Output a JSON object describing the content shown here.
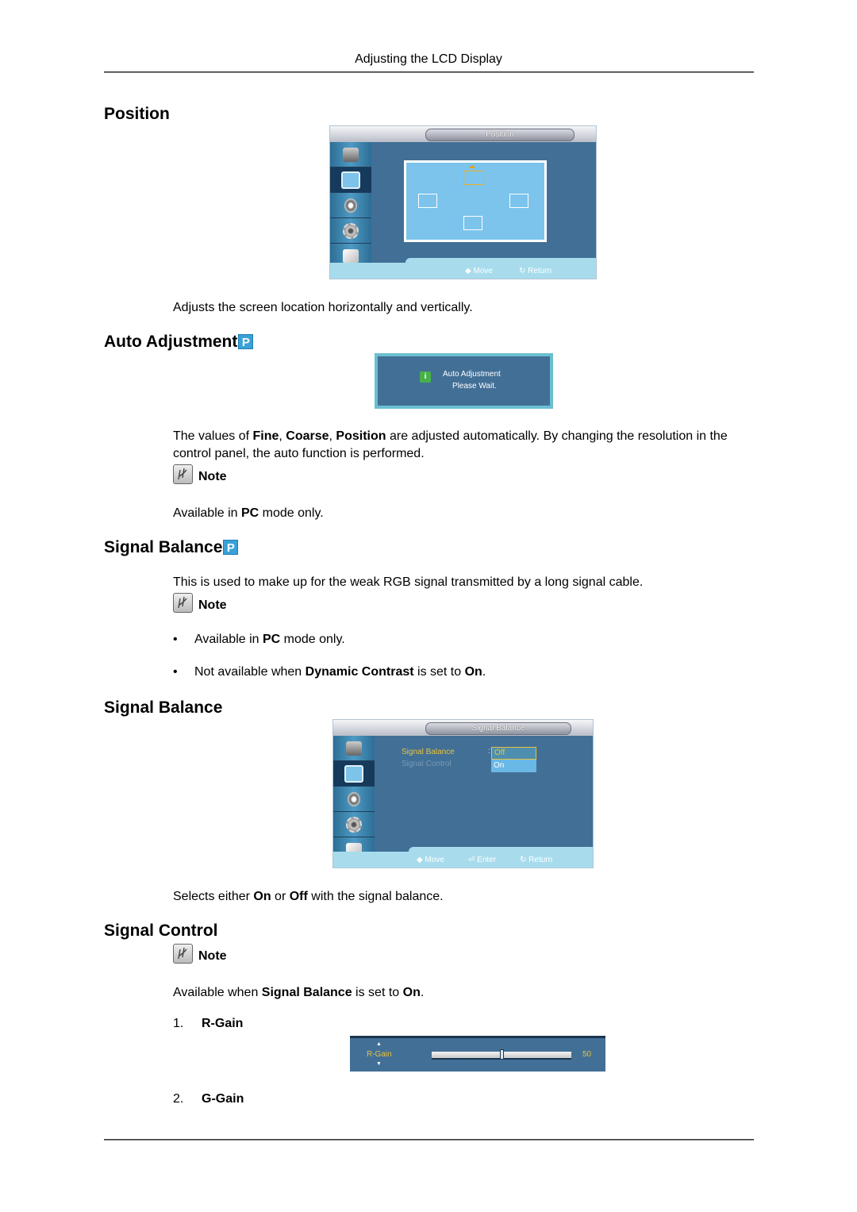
{
  "header": {
    "title": "Adjusting the LCD Display"
  },
  "sections": {
    "position": {
      "heading": "Position",
      "osd": {
        "title": "Position",
        "footer": {
          "move": "Move",
          "return": "Return"
        }
      },
      "description": "Adjusts the screen location horizontally and vertically."
    },
    "auto_adjustment": {
      "heading": "Auto Adjustment",
      "badge": "P",
      "osd": {
        "line1": "Auto Adjustment",
        "line2": "Please Wait."
      },
      "desc_parts": [
        "The values of ",
        "Fine",
        ", ",
        "Coarse",
        ", ",
        "Position",
        " are adjusted automatically. By changing the resolution in the control panel, the auto function is performed."
      ],
      "note_label": "Note",
      "note_parts": [
        "Available in ",
        "PC",
        " mode only."
      ]
    },
    "signal_balance_intro": {
      "heading": "Signal Balance",
      "badge": "P",
      "description": "This is used to make up for the weak RGB signal transmitted by a long signal cable.",
      "note_label": "Note",
      "bullets": [
        {
          "parts": [
            "Available in ",
            "PC",
            " mode only."
          ]
        },
        {
          "parts": [
            "Not available when ",
            "Dynamic Contrast",
            " is set to ",
            "On",
            "."
          ]
        }
      ],
      "bullet_char": "•"
    },
    "signal_balance": {
      "heading": "Signal Balance",
      "osd": {
        "title": "Signal Balance",
        "menu_items": [
          "Signal Balance",
          "Signal Control"
        ],
        "selected_item": "Signal Balance",
        "colon": ":",
        "options": [
          "Off",
          "On"
        ],
        "selected_option": "Off",
        "footer": {
          "move": "Move",
          "enter": "Enter",
          "return": "Return"
        }
      },
      "desc_parts": [
        "Selects either ",
        "On",
        " or ",
        "Off",
        " with the signal balance."
      ]
    },
    "signal_control": {
      "heading": "Signal Control",
      "note_label": "Note",
      "note_parts": [
        "Available when ",
        "Signal Balance",
        " is set to ",
        "On",
        "."
      ],
      "items": [
        {
          "num": "1.",
          "label": "R-Gain"
        },
        {
          "num": "2.",
          "label": "G-Gain"
        }
      ],
      "rgain_osd": {
        "label": "R-Gain",
        "value": "50",
        "level_fraction": 0.5
      }
    }
  },
  "colors": {
    "osd_bg": "#426f96",
    "osd_highlight": "#e8c23a",
    "badge": "#3aa0d8"
  }
}
